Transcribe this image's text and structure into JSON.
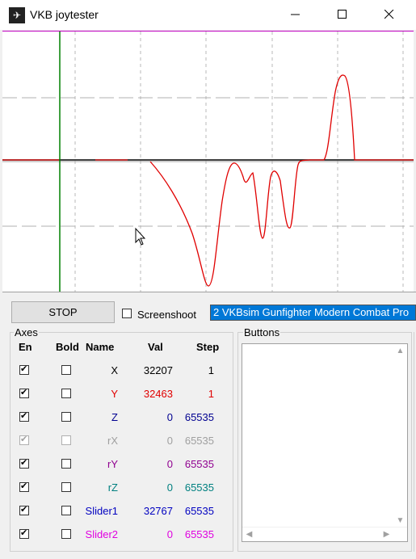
{
  "window": {
    "title": "VKB joytester",
    "icon": "joystick-app-icon"
  },
  "controls": {
    "stop_label": "STOP",
    "screenshot_label": "Screenshoot",
    "screenshot_checked": false,
    "device_selected": "2  VKBsim Gunfighter Modern Combat Pro"
  },
  "axes": {
    "group_title": "Axes",
    "headers": {
      "en": "En",
      "bold": "Bold",
      "name": "Name",
      "val": "Val",
      "step": "Step"
    },
    "rows": [
      {
        "name": "X",
        "val": "32207",
        "step": "1",
        "color": "#000000",
        "enabled": true,
        "bold": false,
        "disabled": false
      },
      {
        "name": "Y",
        "val": "32463",
        "step": "1",
        "color": "#e00000",
        "enabled": true,
        "bold": false,
        "disabled": false
      },
      {
        "name": "Z",
        "val": "0",
        "step": "65535",
        "color": "#000090",
        "enabled": true,
        "bold": false,
        "disabled": false
      },
      {
        "name": "rX",
        "val": "0",
        "step": "65535",
        "color": "#a0a0a0",
        "enabled": true,
        "bold": false,
        "disabled": true
      },
      {
        "name": "rY",
        "val": "0",
        "step": "65535",
        "color": "#900090",
        "enabled": true,
        "bold": false,
        "disabled": false
      },
      {
        "name": "rZ",
        "val": "0",
        "step": "65535",
        "color": "#008080",
        "enabled": true,
        "bold": false,
        "disabled": false
      },
      {
        "name": "Slider1",
        "val": "32767",
        "step": "65535",
        "color": "#0000c0",
        "enabled": true,
        "bold": false,
        "disabled": false
      },
      {
        "name": "Slider2",
        "val": "0",
        "step": "65535",
        "color": "#e000e0",
        "enabled": true,
        "bold": false,
        "disabled": false
      }
    ]
  },
  "buttons_panel": {
    "group_title": "Buttons",
    "items": []
  },
  "graph": {
    "top_line_color": "#c000c0",
    "trace_color": "#e00000",
    "cursor_line_color": "#008000",
    "center_line_color": "#000000"
  }
}
